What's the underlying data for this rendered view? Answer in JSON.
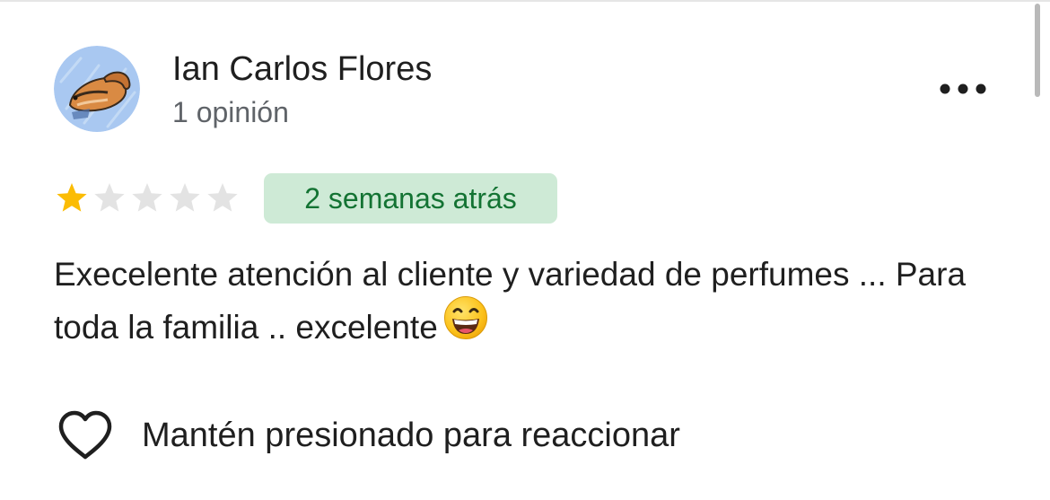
{
  "review": {
    "author": {
      "name": "Ian Carlos Flores",
      "review_count": "1 opinión",
      "avatar_icon": "squirrel-avatar-icon"
    },
    "more_options_icon": "more-horizontal-icon",
    "rating": {
      "value": 1,
      "max": 5,
      "filled_color": "#fbbc04",
      "empty_color": "#e3e3e3"
    },
    "time_ago": "2 semanas atrás",
    "text": "Execelente atención al cliente y variedad de perfumes ... Para toda la familia .. excelente",
    "emoji": "grinning-face-with-smiling-eyes",
    "reaction": {
      "icon": "heart-outline-icon",
      "label": "Mantén presionado para reaccionar"
    }
  },
  "colors": {
    "badge_bg": "#ceead6",
    "badge_text": "#137333",
    "secondary_text": "#5f6368"
  }
}
